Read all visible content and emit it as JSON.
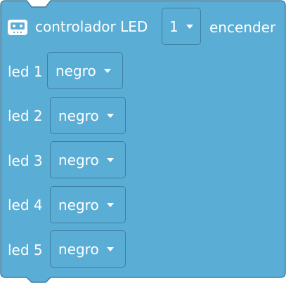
{
  "block": {
    "title": "controlador LED",
    "controller_select": {
      "value": "1"
    },
    "action": "encender",
    "colors": {
      "fill": "#5aaed6",
      "stroke": "#3f7fa1",
      "text": "#ffffff"
    }
  },
  "leds": [
    {
      "label": "led 1",
      "color_value": "negro"
    },
    {
      "label": "led 2",
      "color_value": "negro"
    },
    {
      "label": "led 3",
      "color_value": "negro"
    },
    {
      "label": "led 4",
      "color_value": "negro"
    },
    {
      "label": "led 5",
      "color_value": "negro"
    }
  ],
  "icons": {
    "header": "robot-icon",
    "dropdown": "caret-down-icon"
  }
}
